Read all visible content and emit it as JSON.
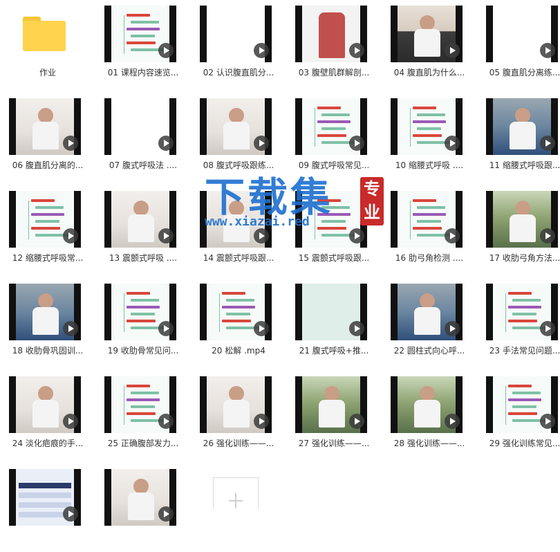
{
  "folder": {
    "label": "作业",
    "icon": "folder-icon",
    "color": "#ffd34d"
  },
  "files": [
    {
      "label": "01 课程内容速览...",
      "kind": "mind"
    },
    {
      "label": "02 认识腹直肌分...",
      "kind": "plain"
    },
    {
      "label": "03 腹壁肌群解剖...",
      "kind": "anat"
    },
    {
      "label": "04 腹直肌为什么...",
      "kind": "photo-a"
    },
    {
      "label": "05 腹直肌分离练...",
      "kind": "plain"
    },
    {
      "label": "06 腹直肌分离的...",
      "kind": "photo-b"
    },
    {
      "label": "07 腹式呼吸法 ....",
      "kind": "plain"
    },
    {
      "label": "08 腹式呼吸跟练...",
      "kind": "photo-b"
    },
    {
      "label": "09 腹式呼吸常见...",
      "kind": "mind"
    },
    {
      "label": "10 缩腰式呼吸 ....",
      "kind": "mind"
    },
    {
      "label": "11 缩腰式呼吸跟...",
      "kind": "photo-d"
    },
    {
      "label": "12 缩腰式呼吸常...",
      "kind": "mind"
    },
    {
      "label": "13 震颤式呼吸 ....",
      "kind": "photo-b"
    },
    {
      "label": "14 震颤式呼吸跟...",
      "kind": "photo-b"
    },
    {
      "label": "15 震颤式呼吸跟...",
      "kind": "mind"
    },
    {
      "label": "16 肋弓角检测 ....",
      "kind": "mind"
    },
    {
      "label": "17 收肋弓角方法...",
      "kind": "photo-c"
    },
    {
      "label": "18 收肋骨巩固训...",
      "kind": "photo-d"
    },
    {
      "label": "19 收肋骨常见问...",
      "kind": "mind"
    },
    {
      "label": "20 松解 .mp4",
      "kind": "mind"
    },
    {
      "label": "21 腹式呼吸+推...",
      "kind": "teal"
    },
    {
      "label": "22 圆柱式向心呼...",
      "kind": "photo-d"
    },
    {
      "label": "23 手法常见问题...",
      "kind": "mind"
    },
    {
      "label": "24 淡化疤痕的手...",
      "kind": "photo-b"
    },
    {
      "label": "25 正确腹部发力...",
      "kind": "mind"
    },
    {
      "label": "26 强化训练——...",
      "kind": "photo-b"
    },
    {
      "label": "27 强化训练——...",
      "kind": "photo-c"
    },
    {
      "label": "28 强化训练——...",
      "kind": "photo-c"
    },
    {
      "label": "29 强化训练常见...",
      "kind": "mind"
    },
    {
      "label": "",
      "kind": "table"
    },
    {
      "label": "",
      "kind": "photo-b"
    }
  ],
  "watermark": {
    "title": "下载集",
    "url": "www.xiazai.red",
    "seal": "专业"
  }
}
